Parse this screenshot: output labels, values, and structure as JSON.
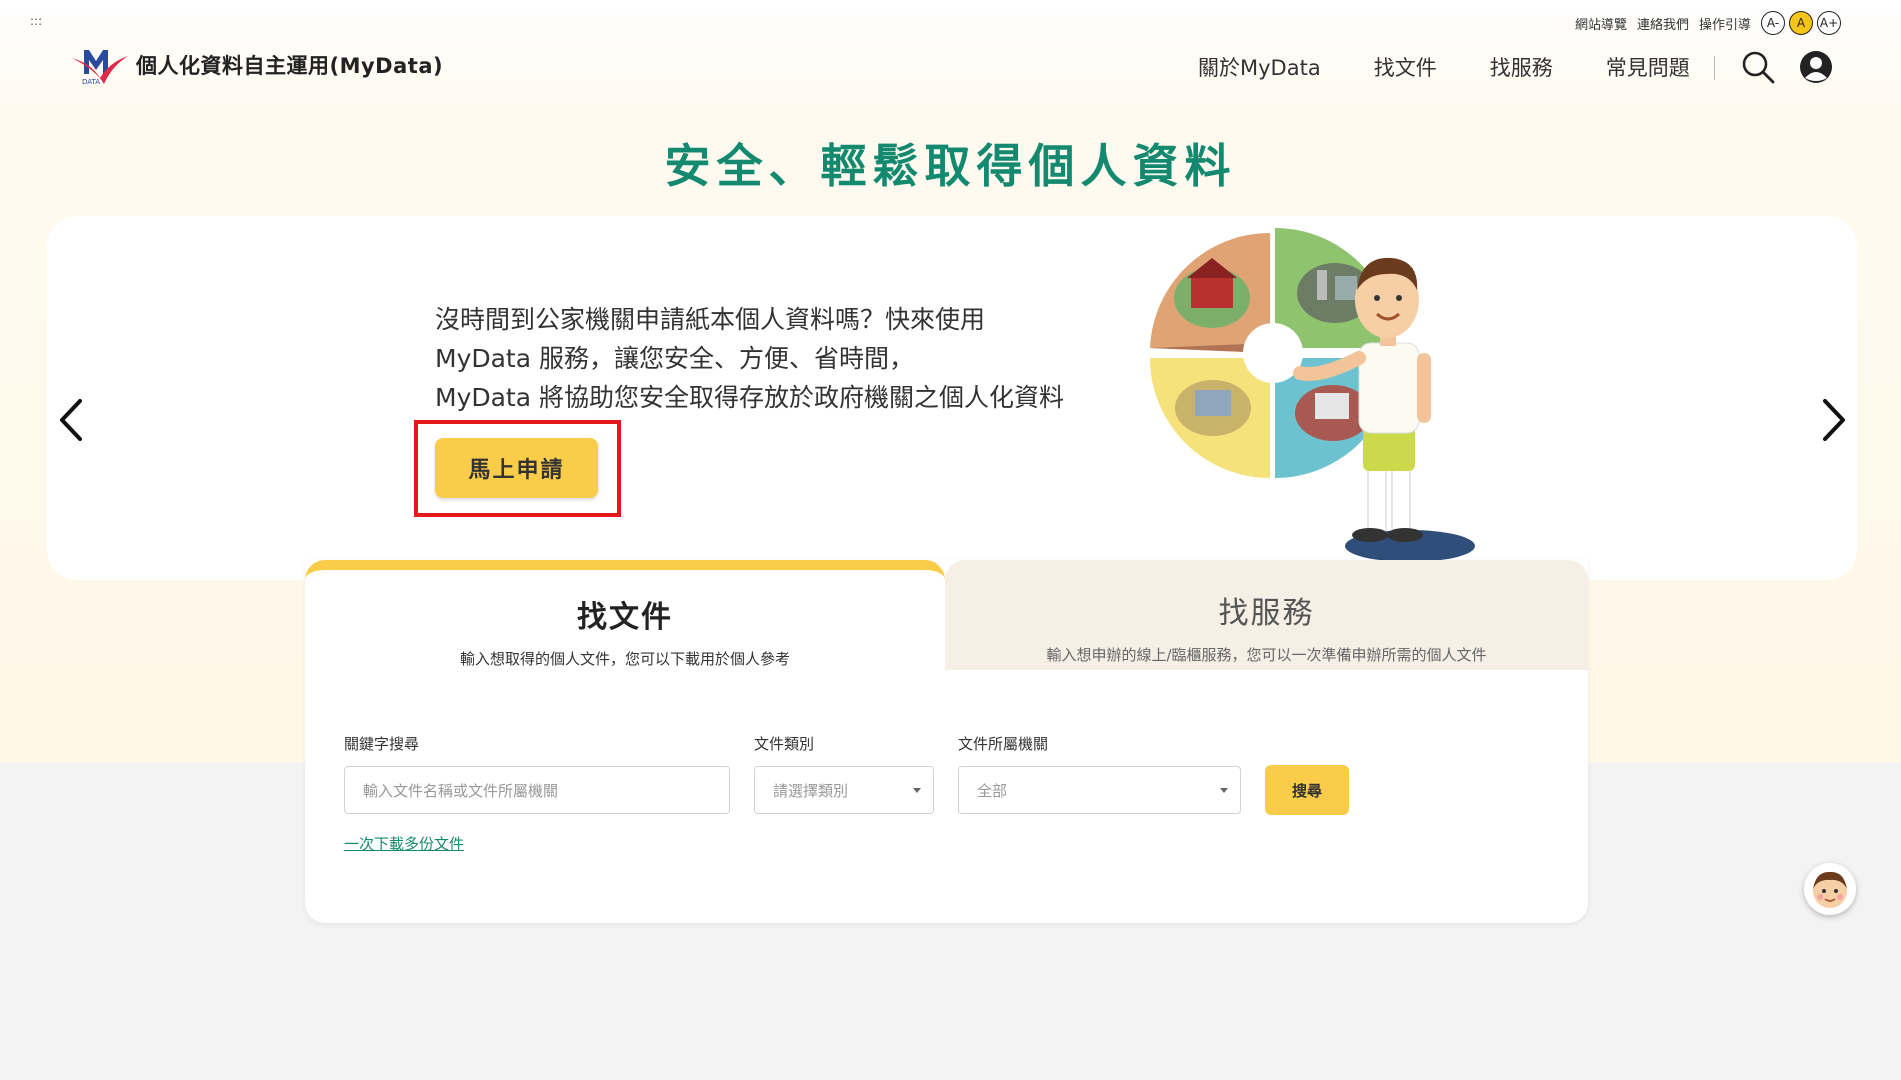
{
  "skip_link": ":::",
  "utility": {
    "links": [
      "網站導覽",
      "連絡我們",
      "操作引導"
    ],
    "font_sizes": [
      {
        "label": "A-",
        "active": false
      },
      {
        "label": "A",
        "active": true
      },
      {
        "label": "A+",
        "active": false
      }
    ]
  },
  "logo": {
    "mark_text": "DATA",
    "site_name": "個人化資料自主運用(MyData)"
  },
  "nav": {
    "items": [
      "關於MyData",
      "找文件",
      "找服務",
      "常見問題"
    ],
    "icons": [
      "search-icon",
      "user-icon"
    ]
  },
  "headline": "安全、輕鬆取得個人資料",
  "carousel": {
    "slide_lines": [
      "沒時間到公家機關申請紙本個人資料嗎？快來使用",
      "MyData 服務，讓您安全、方便、省時間，",
      "MyData 將協助您安全取得存放於政府機關之個人化資料"
    ],
    "apply_button": "馬上申請",
    "prev_icon": "chevron-left-icon",
    "next_icon": "chevron-right-icon"
  },
  "tabs": [
    {
      "title": "找文件",
      "desc": "輸入想取得的個人文件，您可以下載用於個人參考",
      "active": true
    },
    {
      "title": "找服務",
      "desc": "輸入想申辦的線上/臨櫃服務，您可以一次準備申辦所需的個人文件",
      "active": false
    }
  ],
  "search_form": {
    "keyword_label": "關鍵字搜尋",
    "keyword_placeholder": "輸入文件名稱或文件所屬機關",
    "category_label": "文件類別",
    "category_value": "請選擇類別",
    "agency_label": "文件所屬機關",
    "agency_value": "全部",
    "search_button": "搜尋",
    "multi_download_link": "一次下載多份文件"
  },
  "colors": {
    "accent_yellow": "#f9cd4a",
    "headline_green": "#138a6f",
    "highlight_red": "#e3191b"
  }
}
